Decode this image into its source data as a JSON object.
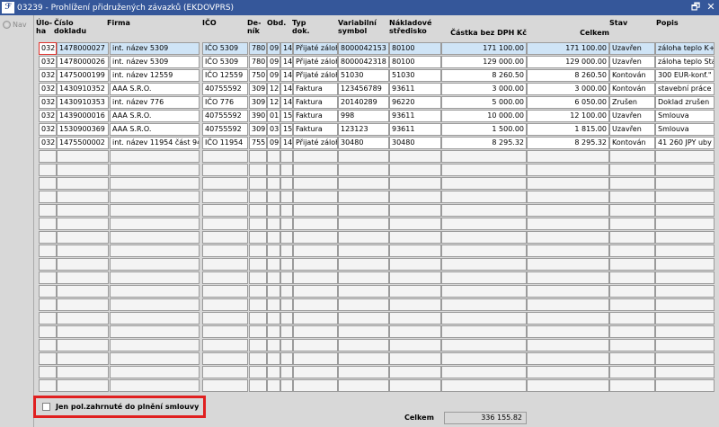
{
  "window": {
    "title": "03239 - Prohlížení přidružených závazků (EKDOVPRS)",
    "logo_text": "ℱ",
    "restore_glyph": "🗗",
    "close_glyph": "✕"
  },
  "nav": {
    "label": "Nav"
  },
  "columns": [
    {
      "key": "uloha",
      "label": "Úlo-\nha"
    },
    {
      "key": "cislo",
      "label": "Číslo\ndokladu"
    },
    {
      "key": "firma",
      "label": "Firma"
    },
    {
      "key": "ico",
      "label": "IČO"
    },
    {
      "key": "den",
      "label": "De-\nník"
    },
    {
      "key": "obd",
      "label": "Obd."
    },
    {
      "key": "rok",
      "label": ""
    },
    {
      "key": "typ",
      "label": "Typ\ndok."
    },
    {
      "key": "var",
      "label": "Variabilní\nsymbol"
    },
    {
      "key": "nakl",
      "label": "Nákladové\nstředisko"
    },
    {
      "key": "castka",
      "label": "Částka bez DPH Kč"
    },
    {
      "key": "celkem",
      "label": "Celkem"
    },
    {
      "key": "stav",
      "label": "Stav"
    },
    {
      "key": "popis",
      "label": "Popis"
    }
  ],
  "rows": [
    [
      "032",
      "1478000027",
      "int. název 5309",
      "IČO 5309",
      "780",
      "09",
      "14",
      "Přijaté záloh",
      "8000042153",
      "80100",
      "171 100.00",
      "171 100.00",
      "Uzavřen",
      "záloha teplo K+"
    ],
    [
      "032",
      "1478000026",
      "int. název 5309",
      "IČO 5309",
      "780",
      "09",
      "14",
      "Přijaté záloh",
      "8000042318",
      "80100",
      "129 000.00",
      "129 000.00",
      "Uzavřen",
      "záloha teplo Sta"
    ],
    [
      "032",
      "1475000199",
      "int. název 12559",
      "IČO 12559",
      "750",
      "09",
      "14",
      "Přijaté záloh",
      "51030",
      "51030",
      "8 260.50",
      "8 260.50",
      "Kontován",
      "300 EUR-konf.\""
    ],
    [
      "032",
      "1430910352",
      "AAA S.R.O.",
      "40755592",
      "309",
      "12",
      "14",
      "Faktura",
      "123456789",
      "93611",
      "3 000.00",
      "3 000.00",
      "Kontován",
      "stavební práce"
    ],
    [
      "032",
      "1430910353",
      "int. název 776",
      "IČO 776",
      "309",
      "12",
      "14",
      "Faktura",
      "20140289",
      "96220",
      "5 000.00",
      "6 050.00",
      "Zrušen",
      "Doklad zrušen"
    ],
    [
      "032",
      "1439000016",
      "AAA S.R.O.",
      "40755592",
      "390",
      "01",
      "15",
      "Faktura",
      "998",
      "93611",
      "10 000.00",
      "12 100.00",
      "Uzavřen",
      "Smlouva"
    ],
    [
      "032",
      "1530900369",
      "AAA S.R.O.",
      "40755592",
      "309",
      "03",
      "15",
      "Faktura",
      "123123",
      "93611",
      "1 500.00",
      "1 815.00",
      "Uzavřen",
      "Smlouva"
    ],
    [
      "032",
      "1475500002",
      "int. název 11954 část 94",
      "IČO 11954",
      "755",
      "09",
      "14",
      "Přijaté záloh",
      "30480",
      "30480",
      "8 295.32",
      "8 295.32",
      "Kontován",
      "41 260 JPY uby"
    ]
  ],
  "empty_row_count": 18,
  "footer": {
    "checkbox_label": "Jen pol.zahrnuté do plnění smlouvy",
    "total_label": "Celkem",
    "total_value": "336 155.82"
  }
}
